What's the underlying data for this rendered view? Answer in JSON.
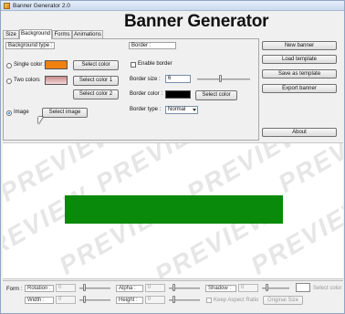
{
  "window": {
    "title": "Banner Generator 2.0"
  },
  "header": {
    "title": "Banner Generator"
  },
  "tabs": [
    {
      "label": "Size"
    },
    {
      "label": "Background"
    },
    {
      "label": "Forms"
    },
    {
      "label": "Animations"
    }
  ],
  "background": {
    "group_label": "Background type :",
    "single_color": {
      "label": "Single color :",
      "color": "#f08010",
      "button": "Select color"
    },
    "two_colors": {
      "label": "Two colors",
      "color_top": "#c98a8a",
      "color_bottom": "#f3d6d6",
      "button1": "Select color 1",
      "button2": "Select color 2"
    },
    "image": {
      "label": "Image",
      "button": "Select image",
      "selected": true
    }
  },
  "border": {
    "group_label": "Border :",
    "enable_label": "Enable border",
    "size_label": "Border size :",
    "size_value": "6",
    "color_label": "Border color :",
    "color": "#000000",
    "color_button": "Select color",
    "type_label": "Border type :",
    "type_value": "Normal"
  },
  "actions": {
    "new_banner": "New banner",
    "load_template": "Load template",
    "save_template": "Save as template",
    "export_banner": "Export banner",
    "about": "About"
  },
  "preview": {
    "watermark": "PREVIEW",
    "banner_color": "#0a8a0a"
  },
  "form": {
    "label": "Form :",
    "rotation_label": "Rotation :",
    "rotation_value": "0",
    "width_label": "Width :",
    "width_value": "0",
    "alpha_label": "Alpha :",
    "alpha_value": "0",
    "height_label": "Height :",
    "height_value": "0",
    "shadow_label": "Shadow :",
    "shadow_value": "0",
    "keep_ratio_label": "Keep Aspect Ratio",
    "original_size": "Original Size",
    "select_color": "Select color"
  }
}
